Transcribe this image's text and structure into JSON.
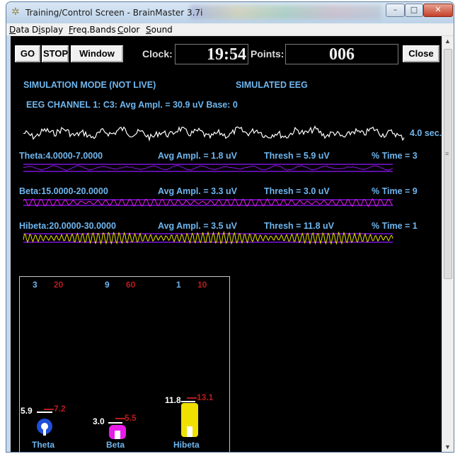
{
  "window": {
    "title": "Training/Control Screen - BrainMaster 3.7i",
    "minimize": "–",
    "maximize": "□",
    "close": "✕"
  },
  "menu": [
    {
      "underline": "D",
      "rest": "ata"
    },
    {
      "pre": "D",
      "underline": "i",
      "rest": "splay"
    },
    {
      "underline": "F",
      "rest": "req.Bands"
    },
    {
      "underline": "C",
      "rest": "olor"
    },
    {
      "underline": "S",
      "rest": "ound"
    }
  ],
  "toolbar": {
    "go": "GO",
    "stop": "STOP",
    "window": "Window",
    "clock_label": "Clock:",
    "clock_value": "19:54",
    "points_label": "Points:",
    "points_value": "006",
    "close": "Close"
  },
  "status": {
    "mode": "SIMULATION MODE (NOT LIVE)",
    "source": "SIMULATED EEG",
    "channel": "EEG CHANNEL 1: C3: Avg Ampl. = 30.9 uV  Base: 0",
    "duration": "4.0 sec."
  },
  "bands": [
    {
      "name": "Theta:4.0000-7.0000",
      "avg": "Avg Ampl. = 1.8 uV",
      "thresh": "Thresh = 5.9 uV",
      "time": "% Time = 3",
      "color": "#8c14e6"
    },
    {
      "name": "Beta:15.0000-20.0000",
      "avg": "Avg Ampl. = 3.3 uV",
      "thresh": "Thresh = 3.0 uV",
      "time": "% Time = 9",
      "color": "#e81ce8"
    },
    {
      "name": "Hibeta:20.0000-30.0000",
      "avg": "Avg Ampl. = 3.5 uV",
      "thresh": "Thresh = 11.8 uV",
      "time": "% Time = 1",
      "color": "#f0e000"
    }
  ],
  "meters": [
    {
      "label": "Theta",
      "pct": "3",
      "target": "20",
      "thresh": "5.9",
      "max": "7.2",
      "color": "#1f4fd8"
    },
    {
      "label": "Beta",
      "pct": "9",
      "target": "60",
      "thresh": "3.0",
      "max": "5.5",
      "color": "#e81ce8"
    },
    {
      "label": "Hibeta",
      "pct": "1",
      "target": "10",
      "thresh": "11.8",
      "max": "13.1",
      "color": "#f0e000"
    }
  ],
  "colors": {
    "label_blue": "#6fb6ee",
    "target_red": "#b81c1c",
    "eeg_white": "#ffffff",
    "reference_purple": "#7a14d8"
  }
}
